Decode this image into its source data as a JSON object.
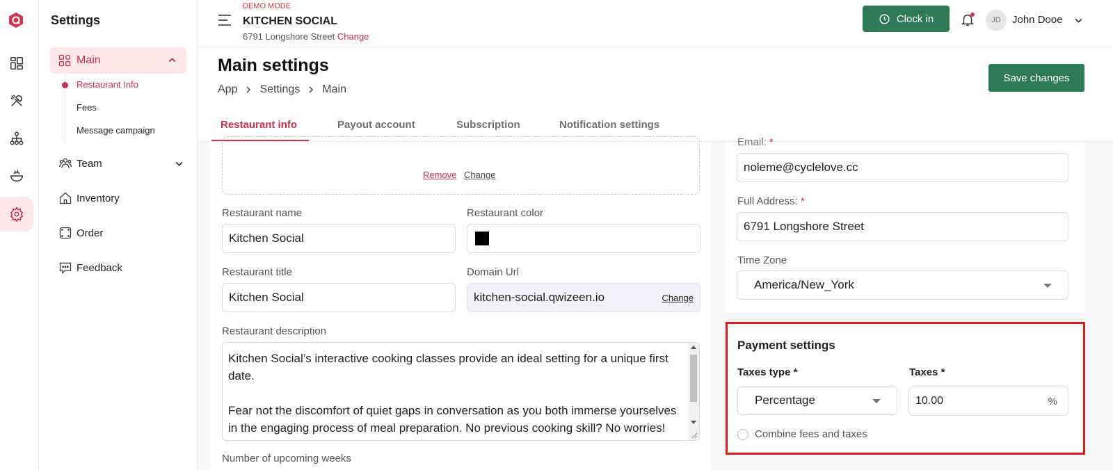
{
  "sidebar": {
    "title": "Settings",
    "main_label": "Main",
    "sub_items": [
      "Restaurant Info",
      "Fees",
      "Message campaign"
    ],
    "links": [
      "Team",
      "Inventory",
      "Order",
      "Feedback"
    ]
  },
  "topbar": {
    "demo_label": "DEMO MODE",
    "restaurant_name": "KITCHEN SOCIAL",
    "address": "6791 Longshore Street",
    "address_change": "Change",
    "clock_in": "Clock in",
    "avatar_initials": "JD",
    "user_name": "John Dooe"
  },
  "page": {
    "title": "Main settings",
    "breadcrumbs": [
      "App",
      "Settings",
      "Main"
    ],
    "save_label": "Save changes"
  },
  "tabs": [
    "Restaurant info",
    "Payout account",
    "Subscription",
    "Notification settings"
  ],
  "logo": {
    "remove": "Remove",
    "change": "Change"
  },
  "form": {
    "name_label": "Restaurant name",
    "name_value": "Kitchen Social",
    "color_label": "Restaurant color",
    "color_value": "#000000",
    "title_label": "Restaurant title",
    "title_value": "Kitchen Social",
    "domain_label": "Domain Url",
    "domain_value": "kitchen-social.qwizeen.io",
    "domain_change": "Change",
    "description_label": "Restaurant description",
    "description_value": "Kitchen Social’s interactive cooking classes provide an ideal setting for a unique first date.\n\nFear not the discomfort of quiet gaps in conversation as you both immerse yourselves in the engaging process of meal preparation. No previous cooking skill? No worries! We encourage an optimistic bit of inexperience to bring the",
    "weeks_label": "Number of upcoming weeks"
  },
  "contact": {
    "email_label": "Email:",
    "email_req": "*",
    "email_value": "noleme@cyclelove.cc",
    "address_label": "Full Address:",
    "address_req": "*",
    "address_value": "6791 Longshore Street",
    "timezone_label": "Time Zone",
    "timezone_value": "America/New_York"
  },
  "payment": {
    "title": "Payment settings",
    "taxes_type_label": "Taxes type *",
    "taxes_type_value": "Percentage",
    "taxes_label": "Taxes *",
    "taxes_value": "10.00",
    "taxes_unit": "%",
    "combine_label": "Combine fees and taxes",
    "combine_checked": false
  },
  "colors": {
    "accent": "#c9304f",
    "primary_button": "#2e7a55",
    "highlight_border": "#e01b1b"
  }
}
